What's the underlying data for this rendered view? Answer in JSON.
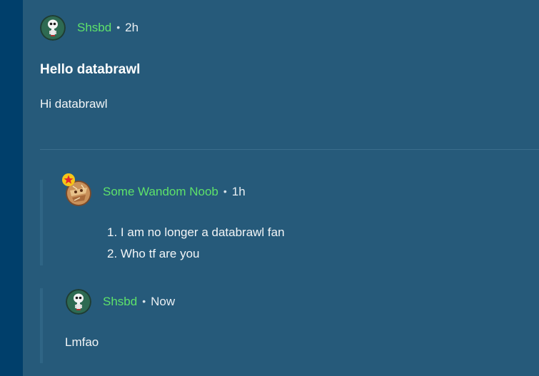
{
  "post": {
    "author": {
      "name": "Shsbd",
      "time": "2h",
      "avatar_icon": "skull-avatar-icon"
    },
    "separator": "•",
    "title": "Hello databrawl",
    "body": "Hi databrawl"
  },
  "replies": [
    {
      "author": {
        "name": "Some Wandom Noob",
        "time": "1h",
        "avatar_icon": "noob-avatar-icon",
        "badge_icon": "star-badge-icon"
      },
      "list": [
        {
          "number": "1.",
          "text": "I am no longer a databrawl fan"
        },
        {
          "number": "2.",
          "text": "Who tf are you"
        }
      ]
    },
    {
      "author": {
        "name": "Shsbd",
        "time": "Now",
        "avatar_icon": "skull-avatar-icon"
      },
      "text": "Lmfao"
    }
  ],
  "colors": {
    "background": "#265a7a",
    "left_strip": "#003f6b",
    "username": "#5ee26a",
    "text": "#f2f5f7"
  }
}
